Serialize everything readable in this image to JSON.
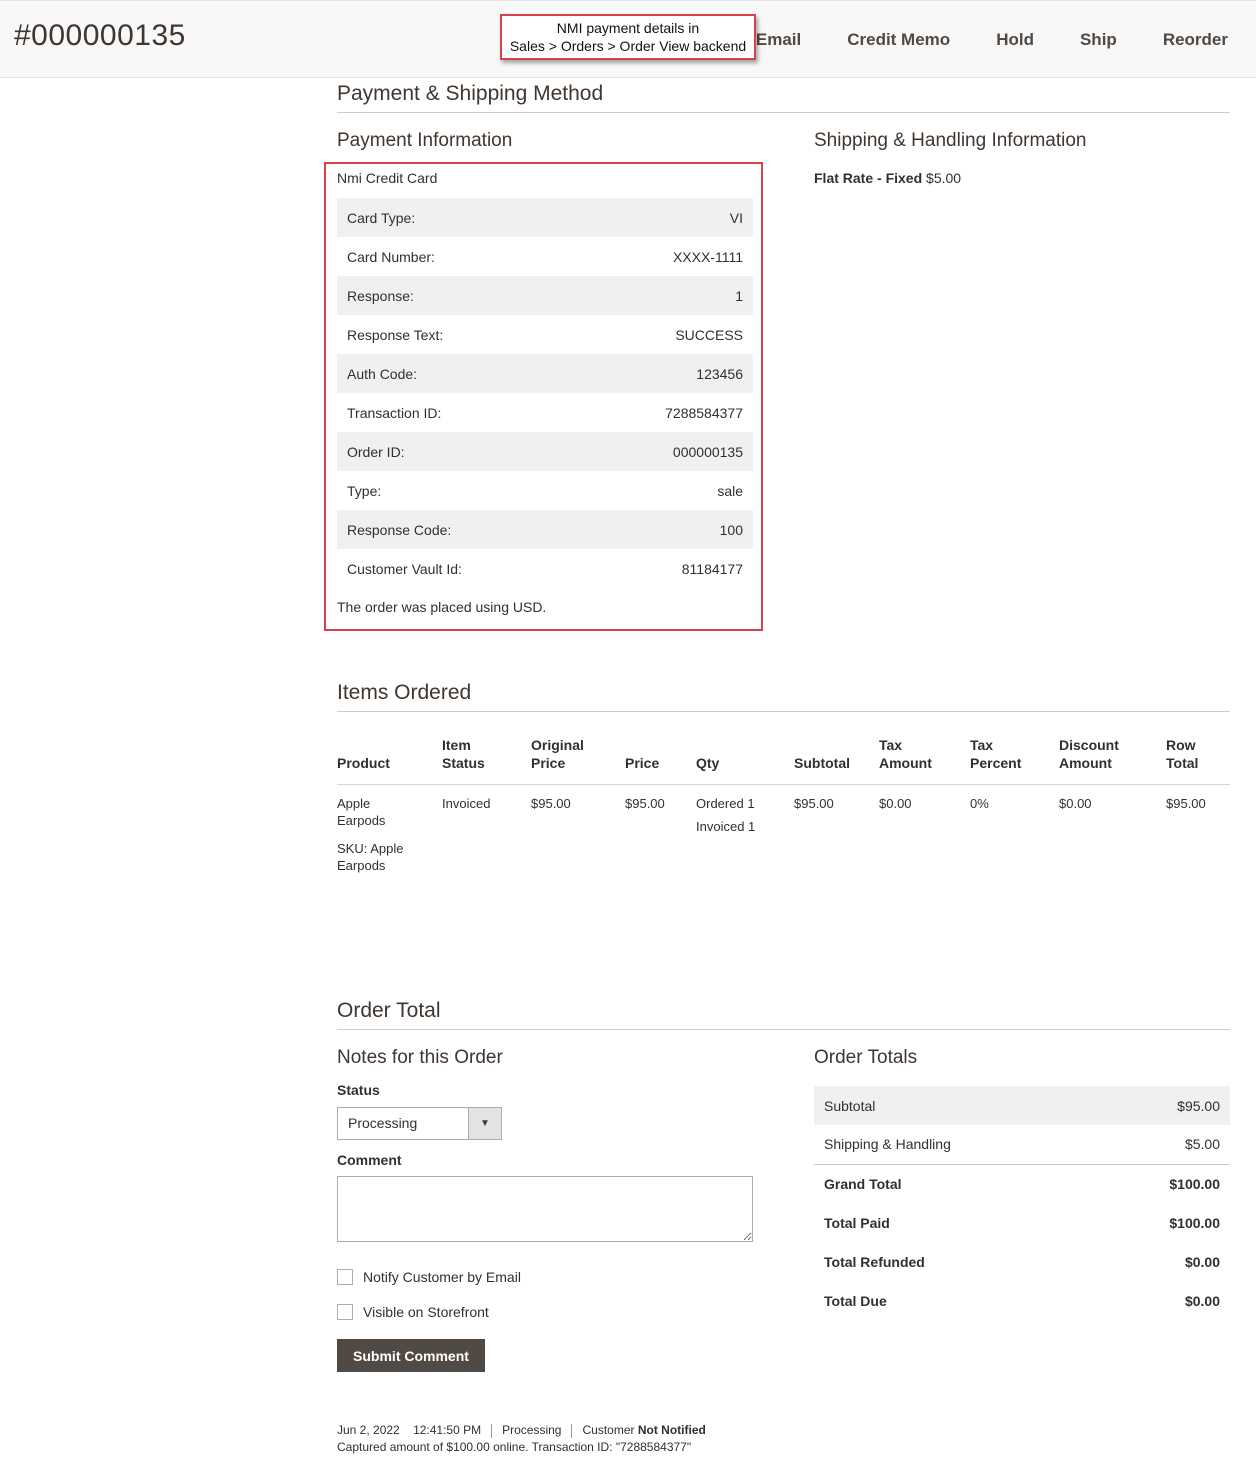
{
  "header": {
    "order_number": "#000000135",
    "actions": [
      "Email",
      "Credit Memo",
      "Hold",
      "Ship",
      "Reorder"
    ],
    "callout_line1": "NMI payment details in",
    "callout_line2": "Sales > Orders > Order View backend"
  },
  "payment_shipping": {
    "section_title": "Payment & Shipping Method",
    "payment_title": "Payment Information",
    "method": "Nmi Credit Card",
    "rows": [
      {
        "label": "Card Type:",
        "value": "VI"
      },
      {
        "label": "Card Number:",
        "value": "XXXX-1111"
      },
      {
        "label": "Response:",
        "value": "1"
      },
      {
        "label": "Response Text:",
        "value": "SUCCESS"
      },
      {
        "label": "Auth Code:",
        "value": "123456"
      },
      {
        "label": "Transaction ID:",
        "value": "7288584377"
      },
      {
        "label": "Order ID:",
        "value": "000000135"
      },
      {
        "label": "Type:",
        "value": "sale"
      },
      {
        "label": "Response Code:",
        "value": "100"
      },
      {
        "label": "Customer Vault Id:",
        "value": "81184177"
      }
    ],
    "currency_note": "The order was placed using USD.",
    "shipping_title": "Shipping & Handling Information",
    "shipping_method": "Flat Rate - Fixed",
    "shipping_price": "$5.00"
  },
  "items": {
    "section_title": "Items Ordered",
    "headers": {
      "product": "Product",
      "item_status_1": "Item",
      "item_status_2": "Status",
      "original_price_1": "Original",
      "original_price_2": "Price",
      "price": "Price",
      "qty": "Qty",
      "subtotal": "Subtotal",
      "tax_amount_1": "Tax",
      "tax_amount_2": "Amount",
      "tax_percent_1": "Tax",
      "tax_percent_2": "Percent",
      "discount_1": "Discount",
      "discount_2": "Amount",
      "row_total_1": "Row",
      "row_total_2": "Total"
    },
    "row": {
      "product_1": "Apple",
      "product_2": "Earpods",
      "sku_1": "SKU: Apple",
      "sku_2": "Earpods",
      "status": "Invoiced",
      "original_price": "$95.00",
      "price": "$95.00",
      "qty_ordered_label": "Ordered",
      "qty_ordered": "1",
      "qty_invoiced_label": "Invoiced",
      "qty_invoiced": "1",
      "subtotal": "$95.00",
      "tax_amount": "$0.00",
      "tax_percent": "0%",
      "discount": "$0.00",
      "row_total": "$95.00"
    }
  },
  "order_total": {
    "section_title": "Order Total",
    "notes_title": "Notes for this Order",
    "status_label": "Status",
    "status_value": "Processing",
    "comment_label": "Comment",
    "notify_label": "Notify Customer by Email",
    "visible_label": "Visible on Storefront",
    "submit_label": "Submit Comment",
    "history": {
      "date": "Jun 2, 2022",
      "time": "12:41:50 PM",
      "status": "Processing",
      "customer_prefix": "Customer",
      "customer_state": "Not Notified",
      "message": "Captured amount of $100.00 online. Transaction ID: \"7288584377\""
    },
    "totals_title": "Order Totals",
    "totals": [
      {
        "label": "Subtotal",
        "value": "$95.00"
      },
      {
        "label": "Shipping & Handling",
        "value": "$5.00"
      },
      {
        "label": "Grand Total",
        "value": "$100.00"
      },
      {
        "label": "Total Paid",
        "value": "$100.00"
      },
      {
        "label": "Total Refunded",
        "value": "$0.00"
      },
      {
        "label": "Total Due",
        "value": "$0.00"
      }
    ]
  },
  "colors": {
    "accent_border": "#d9404a",
    "button_dark": "#514943",
    "row_shade": "#f0f0f0"
  }
}
